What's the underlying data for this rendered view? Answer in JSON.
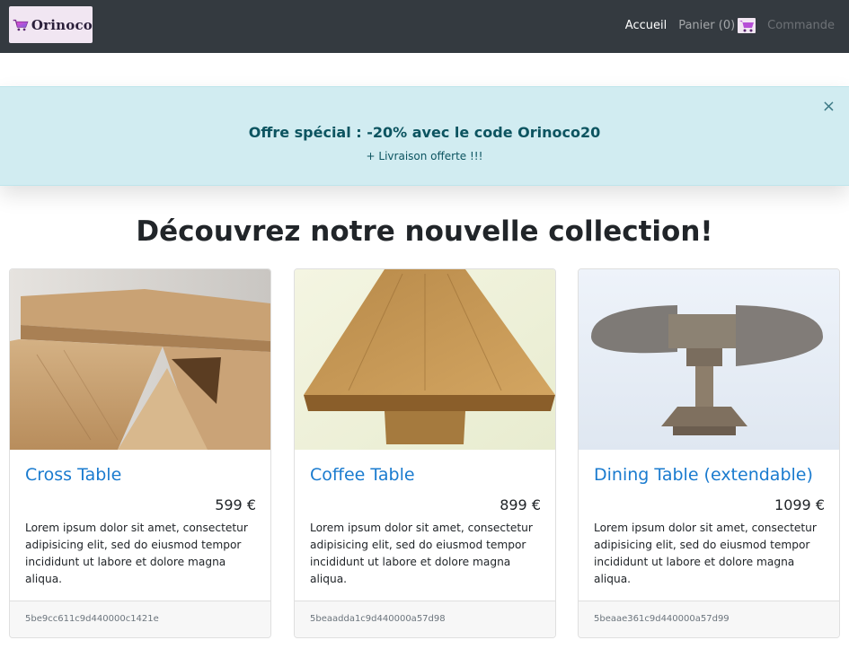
{
  "navbar": {
    "logo_text": "Orinoco",
    "links": [
      {
        "label": "Accueil"
      },
      {
        "label": "Panier (0)"
      },
      {
        "label": "Commande"
      }
    ]
  },
  "banner": {
    "title": "Offre spécial : -20% avec le code Orinoco20",
    "subtitle": "+ Livraison offerte !!!",
    "close_symbol": "×"
  },
  "main": {
    "heading": "Découvrez notre nouvelle collection!"
  },
  "products": [
    {
      "name": "Cross Table",
      "price": "599 €",
      "description": "Lorem ipsum dolor sit amet, consectetur adipisicing elit, sed do eiusmod tempor incididunt ut labore et dolore magna aliqua.",
      "id": "5be9cc611c9d440000c1421e"
    },
    {
      "name": "Coffee Table",
      "price": "899 €",
      "description": "Lorem ipsum dolor sit amet, consectetur adipisicing elit, sed do eiusmod tempor incididunt ut labore et dolore magna aliqua.",
      "id": "5beaadda1c9d440000a57d98"
    },
    {
      "name": "Dining Table (extendable)",
      "price": "1099 €",
      "description": "Lorem ipsum dolor sit amet, consectetur adipisicing elit, sed do eiusmod tempor incididunt ut labore et dolore magna aliqua.",
      "id": "5beaae361c9d440000a57d99"
    }
  ],
  "icons": {
    "logo": "shopping-cart-icon",
    "cart": "shopping-cart-icon",
    "close": "close-icon"
  },
  "colors": {
    "navbar": "#343a40",
    "banner_bg": "#d1ecf1",
    "banner_text": "#0c5460",
    "link": "#1a7bcf",
    "logo_bg": "#f1e6f2"
  }
}
